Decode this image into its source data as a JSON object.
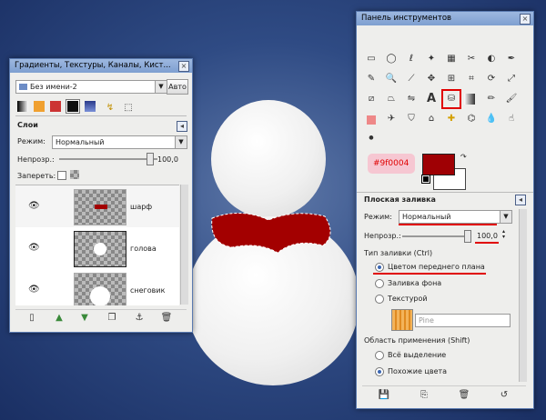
{
  "layers_window": {
    "title": "Градиенты, Текстуры, Каналы, Кист...",
    "image_selector": "Без имени-2",
    "auto_button": "Авто",
    "section_title": "Слои",
    "mode_label": "Режим:",
    "mode_value": "Нормальный",
    "opacity_label": "Непрозр.:",
    "opacity_value": "100,0",
    "lock_label": "Запереть:",
    "layers": [
      {
        "name": "шарф"
      },
      {
        "name": "голова"
      },
      {
        "name": "снеговик"
      }
    ]
  },
  "toolbox_window": {
    "title": "Панель инструментов",
    "fg_color_label": "#9f0004",
    "colors": {
      "foreground": "#9f0004",
      "background": "#ffffff",
      "accent": "#e00000"
    },
    "tool_options": {
      "title": "Плоская заливка",
      "mode_label": "Режим:",
      "mode_value": "Нормальный",
      "opacity_label": "Непрозр.:",
      "opacity_value": "100,0",
      "fill_type_label": "Тип заливки  (Ctrl)",
      "fill_options": [
        "Цветом переднего плана",
        "Заливка фона",
        "Текстурой"
      ],
      "fill_selected": 0,
      "pattern_name": "Pine",
      "area_label": "Область применения  (Shift)",
      "area_options": [
        "Всё выделение",
        "Похожие цвета"
      ],
      "area_selected": 1
    }
  }
}
